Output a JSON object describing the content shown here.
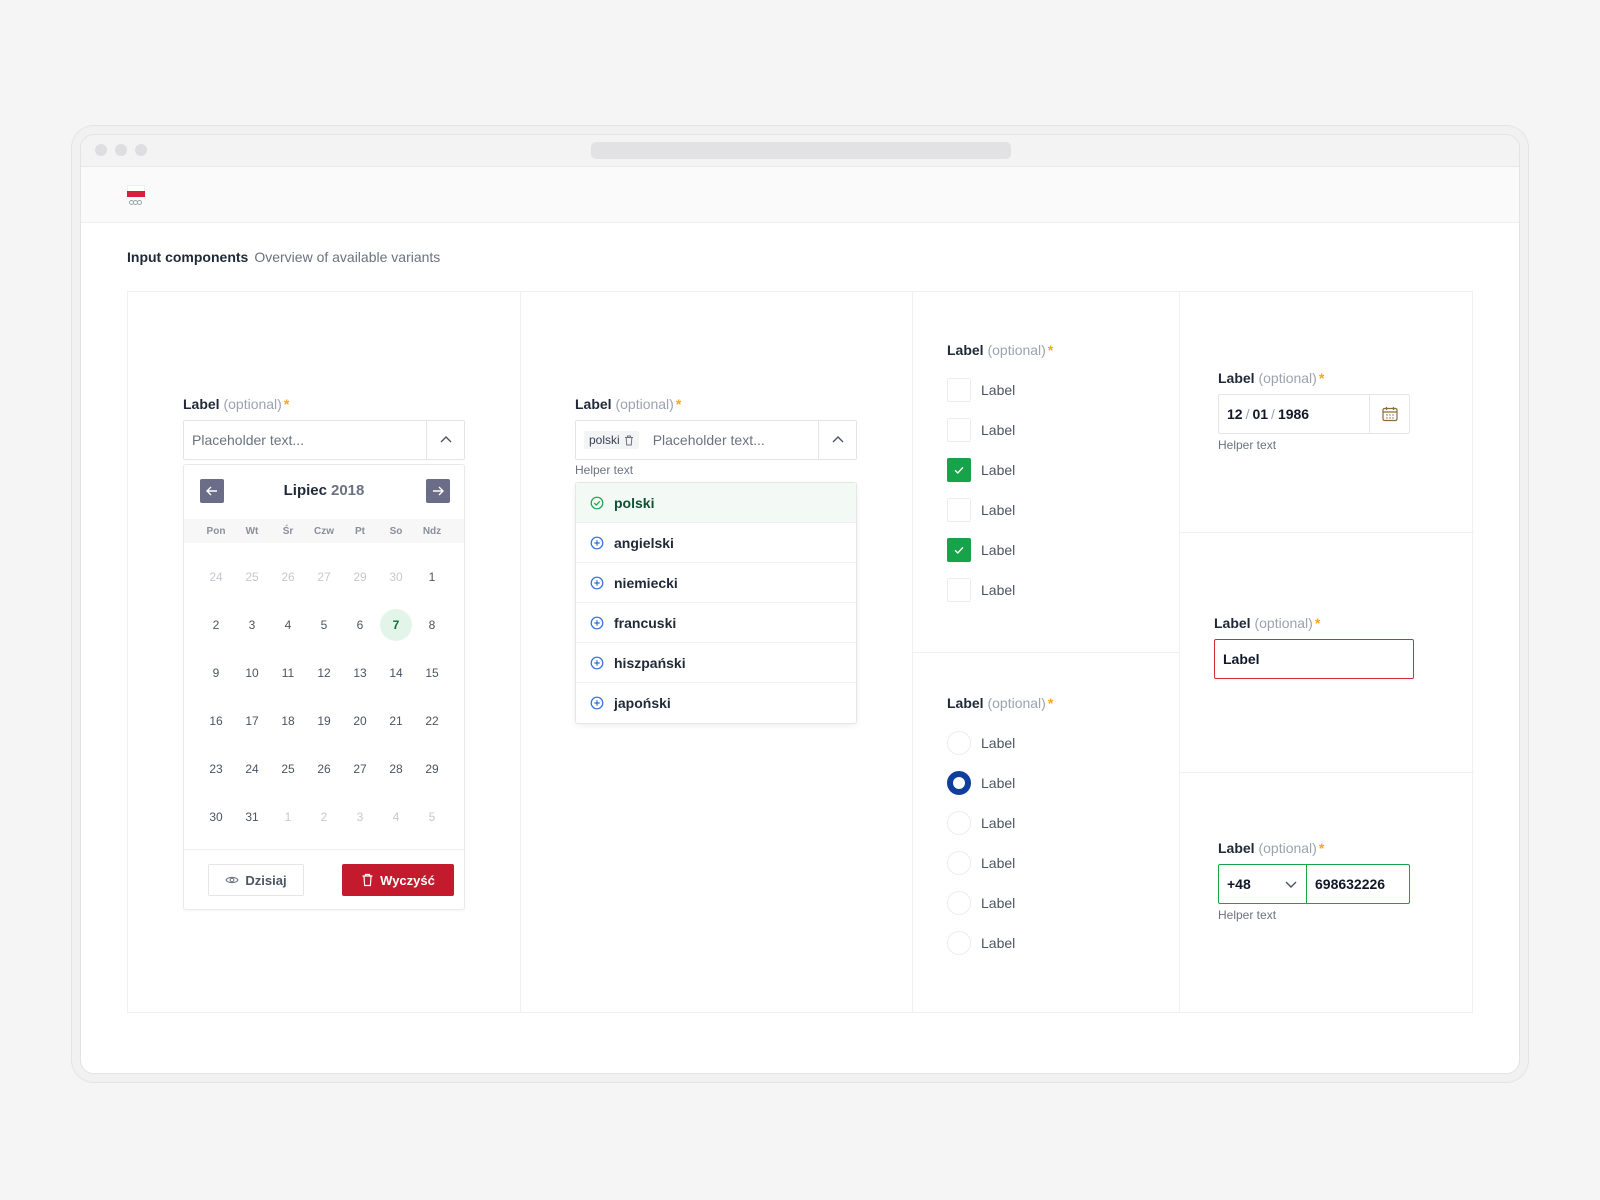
{
  "header": {
    "title": "Input components",
    "subtitle": "Overview of available variants"
  },
  "field": {
    "label": "Label",
    "optional": "(optional)",
    "required": "*",
    "helper": "Helper text"
  },
  "datepicker": {
    "placeholder": "Placeholder text...",
    "month": "Lipiec",
    "year": "2018",
    "weekdays": [
      "Pon",
      "Wt",
      "Śr",
      "Czw",
      "Pt",
      "So",
      "Ndz"
    ],
    "days": [
      {
        "d": "24",
        "muted": true
      },
      {
        "d": "25",
        "muted": true
      },
      {
        "d": "26",
        "muted": true
      },
      {
        "d": "27",
        "muted": true
      },
      {
        "d": "29",
        "muted": true
      },
      {
        "d": "30",
        "muted": true
      },
      {
        "d": "1"
      },
      {
        "d": "2"
      },
      {
        "d": "3"
      },
      {
        "d": "4"
      },
      {
        "d": "5"
      },
      {
        "d": "6"
      },
      {
        "d": "7",
        "selected": true
      },
      {
        "d": "8"
      },
      {
        "d": "9"
      },
      {
        "d": "10"
      },
      {
        "d": "11"
      },
      {
        "d": "12"
      },
      {
        "d": "13"
      },
      {
        "d": "14"
      },
      {
        "d": "15"
      },
      {
        "d": "16"
      },
      {
        "d": "17"
      },
      {
        "d": "18"
      },
      {
        "d": "19"
      },
      {
        "d": "20"
      },
      {
        "d": "21"
      },
      {
        "d": "22"
      },
      {
        "d": "23"
      },
      {
        "d": "24"
      },
      {
        "d": "25"
      },
      {
        "d": "26"
      },
      {
        "d": "27"
      },
      {
        "d": "28"
      },
      {
        "d": "29"
      },
      {
        "d": "30"
      },
      {
        "d": "31"
      },
      {
        "d": "1",
        "muted": true
      },
      {
        "d": "2",
        "muted": true
      },
      {
        "d": "3",
        "muted": true
      },
      {
        "d": "4",
        "muted": true
      },
      {
        "d": "5",
        "muted": true
      }
    ],
    "today_button": "Dzisiaj",
    "clear_button": "Wyczyść"
  },
  "multiselect": {
    "chip": "polski",
    "placeholder": "Placeholder text...",
    "options": [
      {
        "label": "polski",
        "selected": true
      },
      {
        "label": "angielski"
      },
      {
        "label": "niemiecki"
      },
      {
        "label": "francuski"
      },
      {
        "label": "hiszpański"
      },
      {
        "label": "japoński"
      }
    ]
  },
  "checkboxes": [
    {
      "label": "Label",
      "checked": false
    },
    {
      "label": "Label",
      "checked": false
    },
    {
      "label": "Label",
      "checked": true
    },
    {
      "label": "Label",
      "checked": false
    },
    {
      "label": "Label",
      "checked": true
    },
    {
      "label": "Label",
      "checked": false
    }
  ],
  "radios": [
    {
      "label": "Label",
      "checked": false
    },
    {
      "label": "Label",
      "checked": true
    },
    {
      "label": "Label",
      "checked": false
    },
    {
      "label": "Label",
      "checked": false
    },
    {
      "label": "Label",
      "checked": false
    },
    {
      "label": "Label",
      "checked": false
    }
  ],
  "date_input": {
    "day": "12",
    "month": "01",
    "year": "1986",
    "sep": "/"
  },
  "error_input": {
    "value": "Label"
  },
  "phone_input": {
    "code": "+48",
    "number": "698632226"
  },
  "colors": {
    "accent_green": "#16a34a",
    "danger_red": "#c41a2e",
    "radio_blue": "#0f3e9c",
    "required_orange": "#f5a623"
  }
}
